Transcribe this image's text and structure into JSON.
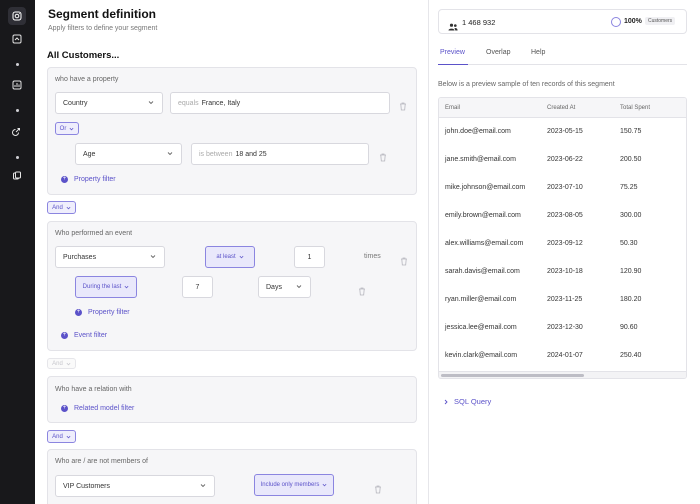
{
  "header": {
    "title": "Segment definition",
    "subtitle": "Apply filters to define your segment",
    "all_customers": "All Customers..."
  },
  "block1": {
    "label": "who have a property",
    "property": "Country",
    "op_placeholder": "equals",
    "value": "France, Italy",
    "or_label": "Or",
    "property2": "Age",
    "op2_placeholder": "is between",
    "value2": "18 and 25",
    "add_filter": "Property filter"
  },
  "and1": "And",
  "block2": {
    "label": "Who performed an event",
    "event": "Purchases",
    "frequency": "at least",
    "count": "1",
    "times": "times",
    "window": "During the last",
    "window_value": "7",
    "window_unit": "Days",
    "add_property": "Property filter",
    "add_event": "Event filter"
  },
  "and2": "And",
  "block3": {
    "label": "Who have a relation with",
    "add_related": "Related model filter"
  },
  "and3": "And",
  "block4": {
    "label": "Who are / are not members of",
    "segment": "VIP Customers",
    "membership": "Include only members"
  },
  "stats": {
    "count": "1 468 932",
    "percent": "100%",
    "percent_label": "Customers"
  },
  "tabs": [
    "Preview",
    "Overlap",
    "Help"
  ],
  "preview_note": "Below is a preview sample of ten records of this segment",
  "table": {
    "columns": [
      "Email",
      "Created At",
      "Total Spent"
    ],
    "rows": [
      [
        "john.doe@email.com",
        "2023-05-15",
        "150.75"
      ],
      [
        "jane.smith@email.com",
        "2023-06-22",
        "200.50"
      ],
      [
        "mike.johnson@email.com",
        "2023-07-10",
        "75.25"
      ],
      [
        "emily.brown@email.com",
        "2023-08-05",
        "300.00"
      ],
      [
        "alex.williams@email.com",
        "2023-09-12",
        "50.30"
      ],
      [
        "sarah.davis@email.com",
        "2023-10-18",
        "120.90"
      ],
      [
        "ryan.miller@email.com",
        "2023-11-25",
        "180.20"
      ],
      [
        "jessica.lee@email.com",
        "2023-12-30",
        "90.60"
      ],
      [
        "kevin.clark@email.com",
        "2024-01-07",
        "250.40"
      ]
    ]
  },
  "sql_query": "SQL Query",
  "colors": {
    "accent": "#5b52c9",
    "rail": "#18181b"
  },
  "icons": {
    "rail": [
      "instagram-icon",
      "share-icon",
      "analytics-icon",
      "link-icon",
      "database-icon"
    ],
    "stats": "users-icon",
    "trash": "trash-icon",
    "chevron": "chevron-down-icon"
  }
}
